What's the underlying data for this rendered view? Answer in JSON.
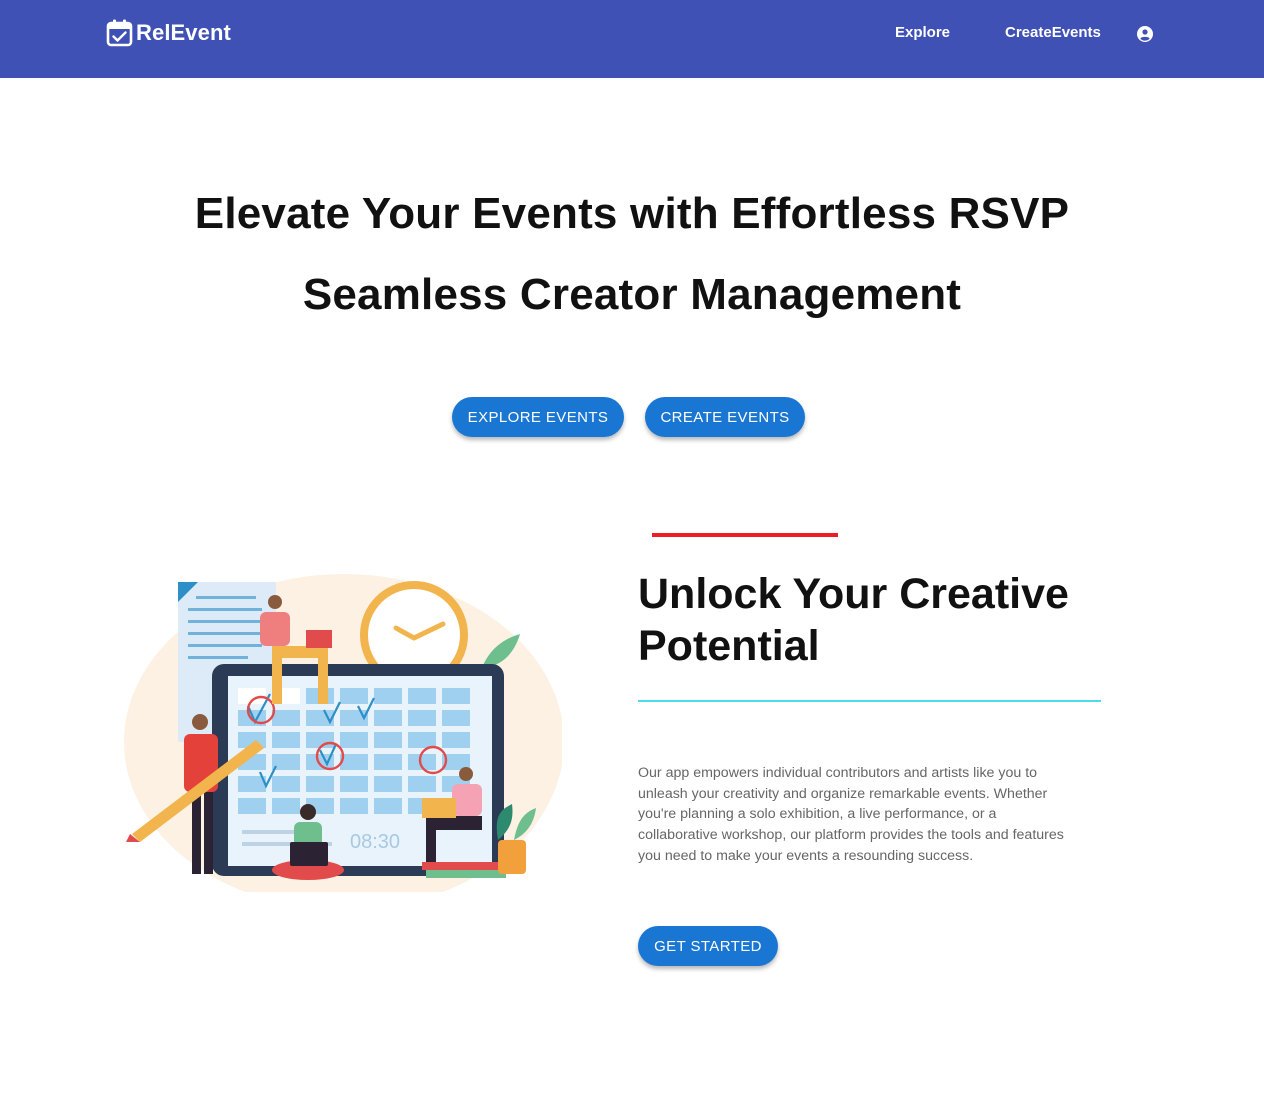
{
  "navbar": {
    "brand": "RelEvent",
    "brand_icon": "calendar-check-icon",
    "links": [
      "Explore",
      "CreateEvents"
    ],
    "account_icon": "account-circle-icon",
    "background_color": "#3f51b5"
  },
  "hero": {
    "line1": "Elevate Your Events with Effortless RSVP",
    "line2": "Seamless Creator Management",
    "buttons": {
      "explore": "EXPLORE EVENTS",
      "create": "CREATE EVENTS"
    },
    "button_color": "#1976d2"
  },
  "feature": {
    "title": "Unlock Your Creative Potential",
    "body": "Our app empowers individual contributors and artists like you to unleash your creativity and organize remarkable events. Whether you're planning a solo exhibition, a live performance, or a collaborative workshop, our platform provides the tools and features you need to make your events a resounding success.",
    "button": "GET STARTED",
    "accent_red": "#ee1c25",
    "accent_cyan": "#4fdcea",
    "illustration": {
      "clock_text": "08:30"
    }
  }
}
